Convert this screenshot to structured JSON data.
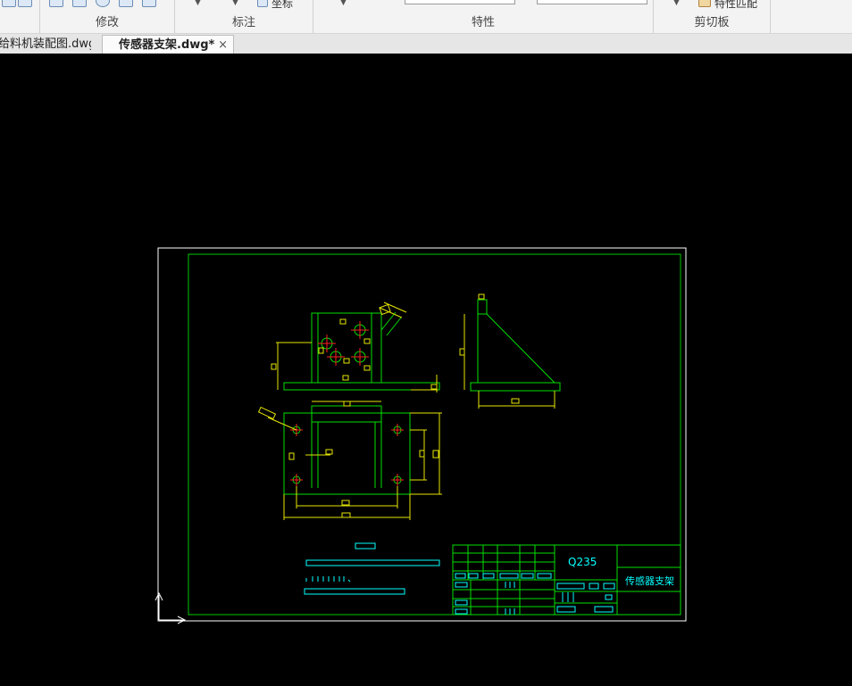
{
  "ribbon": {
    "groups": [
      {
        "label": "修改"
      },
      {
        "label": "标注"
      },
      {
        "label": "特性"
      },
      {
        "label": "剪切板"
      }
    ],
    "coord_label": "坐标",
    "match_label": "特性匹配"
  },
  "tabs": [
    {
      "label": "给料机装配图.dwg"
    },
    {
      "label": "传感器支架.dwg*",
      "close": "×"
    }
  ],
  "drawing": {
    "title_block": {
      "material": "Q235",
      "part_name": "传感器支架"
    }
  },
  "colors": {
    "frame": "#ffffff",
    "border": "#00c800",
    "geometry": "#00e000",
    "dimension": "#e6e600",
    "centerline": "#ff2020",
    "text": "#00ffff"
  }
}
